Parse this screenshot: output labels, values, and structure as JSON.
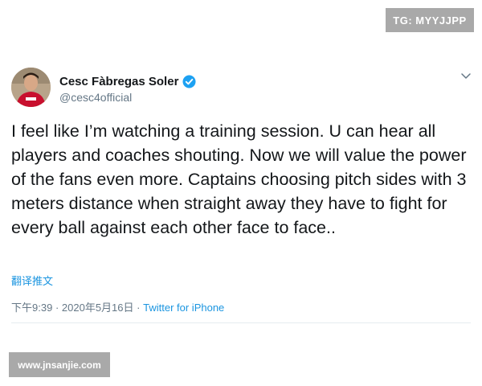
{
  "watermarks": {
    "top_right": "TG: MYYJJPP",
    "bottom_left": "www.jnsanjie.com"
  },
  "tweet": {
    "display_name": "Cesc Fàbregas Soler",
    "handle": "@cesc4official",
    "verified": true,
    "text": "I feel like I’m watching a training session. U can hear all players and coaches shouting. Now we will value the power of the fans even more. Captains choosing pitch sides with 3 meters distance when straight away they have to fight for every ball against each other face to face..",
    "translate_label": "翻译推文",
    "time": "下午9:39",
    "separator": "·",
    "date": "2020年5月16日",
    "source": "Twitter for iPhone"
  },
  "colors": {
    "verified_blue": "#1da1f2",
    "link_blue": "#1b95e0",
    "muted_gray": "#657786",
    "watermark_gray": "#a9a9a9"
  },
  "icons": {
    "verified": "verified-badge-icon",
    "more": "chevron-down-icon"
  }
}
